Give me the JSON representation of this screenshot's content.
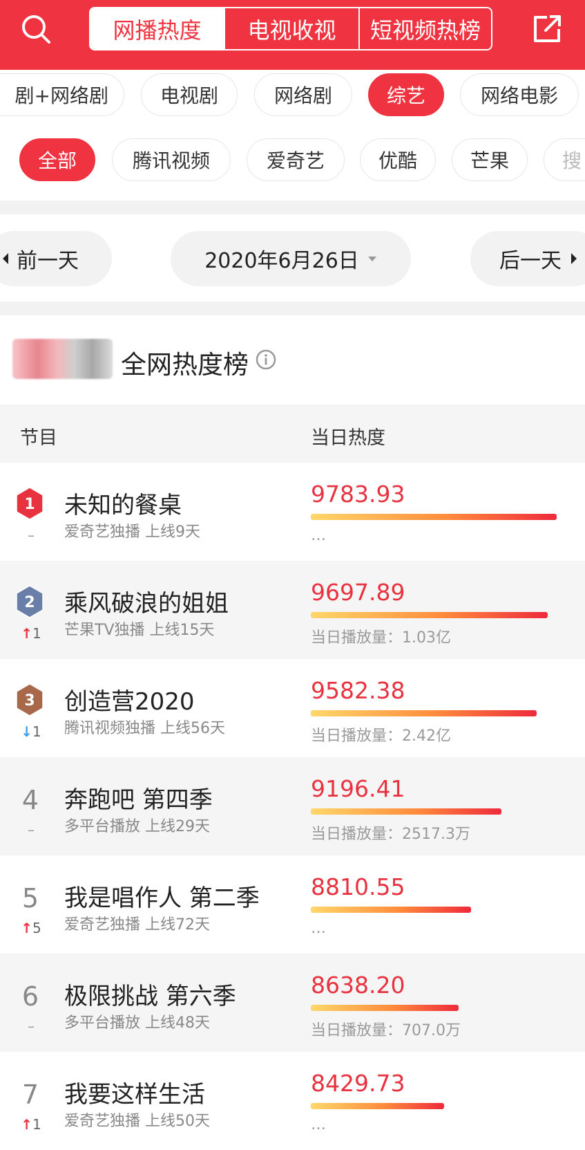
{
  "header": {
    "tabs": [
      "网播热度",
      "电视收视",
      "短视频热榜"
    ],
    "active_tab": 0
  },
  "categories": {
    "items": [
      "剧+网络剧",
      "电视剧",
      "网络剧",
      "综艺",
      "网络电影"
    ],
    "active": 3
  },
  "platforms": {
    "items": [
      "全部",
      "腾讯视频",
      "爱奇艺",
      "优酷",
      "芒果",
      "搜"
    ],
    "active": 0
  },
  "date_nav": {
    "prev": "前一天",
    "date": "2020年6月26日",
    "next": "后一天"
  },
  "board": {
    "title": "全网热度榜"
  },
  "table": {
    "col_program": "节目",
    "col_heat": "当日热度",
    "rows": [
      {
        "rank": "1",
        "trend": "–",
        "trend_dir": "none",
        "name": "未知的餐桌",
        "sub": "爱奇艺独播  上线9天",
        "score": "9783.93",
        "heat": 9783.93,
        "extra": "…"
      },
      {
        "rank": "2",
        "trend": "1",
        "trend_dir": "up",
        "name": "乘风破浪的姐姐",
        "sub": "芒果TV独播  上线15天",
        "score": "9697.89",
        "heat": 9697.89,
        "extra": "当日播放量：1.03亿"
      },
      {
        "rank": "3",
        "trend": "1",
        "trend_dir": "down",
        "name": "创造营2020",
        "sub": "腾讯视频独播  上线56天",
        "score": "9582.38",
        "heat": 9582.38,
        "extra": "当日播放量：2.42亿"
      },
      {
        "rank": "4",
        "trend": "–",
        "trend_dir": "none",
        "name": "奔跑吧 第四季",
        "sub": "多平台播放  上线29天",
        "score": "9196.41",
        "heat": 9196.41,
        "extra": "当日播放量：2517.3万"
      },
      {
        "rank": "5",
        "trend": "5",
        "trend_dir": "up",
        "name": "我是唱作人 第二季",
        "sub": "爱奇艺独播  上线72天",
        "score": "8810.55",
        "heat": 8810.55,
        "extra": "…"
      },
      {
        "rank": "6",
        "trend": "–",
        "trend_dir": "none",
        "name": "极限挑战 第六季",
        "sub": "多平台播放  上线48天",
        "score": "8638.20",
        "heat": 8638.2,
        "extra": "当日播放量：707.0万"
      },
      {
        "rank": "7",
        "trend": "1",
        "trend_dir": "up",
        "name": "我要这样生活",
        "sub": "爱奇艺独播  上线50天",
        "score": "8429.73",
        "heat": 8429.73,
        "extra": "…"
      }
    ]
  },
  "colors": {
    "brand_red": "#ef3340",
    "score_red": "#e8323f",
    "up": "#e8323f",
    "down": "#3a9ee8",
    "medal_gold": "#e8323f",
    "medal_silver": "#6a7fa8",
    "medal_bronze": "#a8684a"
  }
}
